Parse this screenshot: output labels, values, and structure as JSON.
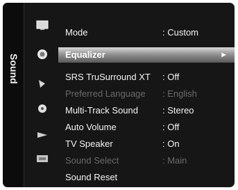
{
  "menu": {
    "tab_label": "Sound",
    "items": [
      {
        "label": "Mode",
        "value": ": Custom",
        "state": "normal"
      },
      {
        "label": "Equalizer",
        "value": "",
        "state": "selected"
      },
      {
        "label": "SRS TruSurround XT",
        "value": ": Off",
        "state": "normal"
      },
      {
        "label": "Preferred Language",
        "value": ": English",
        "state": "disabled"
      },
      {
        "label": "Multi-Track Sound",
        "value": ": Stereo",
        "state": "normal"
      },
      {
        "label": "Auto Volume",
        "value": ": Off",
        "state": "normal"
      },
      {
        "label": "TV Speaker",
        "value": ": On",
        "state": "normal"
      },
      {
        "label": "Sound Select",
        "value": ": Main",
        "state": "disabled"
      },
      {
        "label": "Sound Reset",
        "value": "",
        "state": "normal"
      }
    ],
    "selected_arrow": "►"
  },
  "side_icons": [
    "picture-icon",
    "sound-icon",
    "setup-icon",
    "input-icon",
    "application-icon",
    "support-icon",
    "tv-icon"
  ]
}
